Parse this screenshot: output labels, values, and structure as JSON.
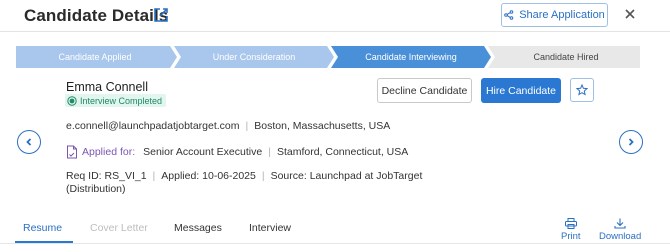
{
  "header": {
    "title": "Candidate Details",
    "share_label": "Share Application",
    "icons": [
      "external-link-icon",
      "share-icon",
      "close-icon"
    ]
  },
  "stepper": {
    "steps": [
      {
        "label": "Candidate Applied",
        "state": "completed"
      },
      {
        "label": "Under Consideration",
        "state": "completed"
      },
      {
        "label": "Candidate Interviewing",
        "state": "current"
      },
      {
        "label": "Candidate Hired",
        "state": "upcoming"
      }
    ],
    "colors": {
      "completed": "#a9c7ec",
      "current": "#4a90d9",
      "upcoming": "#e8e8e8"
    }
  },
  "candidate": {
    "name": "Emma Connell",
    "status": "Interview Completed",
    "email": "e.connell@launchpadatjobtarget.com",
    "location": "Boston, Massachusetts, USA",
    "applied_for_label": "Applied for:",
    "position": "Senior Account Executive",
    "position_location": "Stamford, Connecticut, USA",
    "req_id": "Req ID: RS_VI_1",
    "applied_date": "Applied: 10-06-2025",
    "source": "Source: Launchpad at JobTarget",
    "source_suffix": "(Distribution)"
  },
  "actions": {
    "decline_label": "Decline Candidate",
    "hire_label": "Hire Candidate",
    "star_icon": "star-icon"
  },
  "tabs": [
    {
      "label": "Resume",
      "state": "active"
    },
    {
      "label": "Cover Letter",
      "state": "disabled"
    },
    {
      "label": "Messages",
      "state": "normal"
    },
    {
      "label": "Interview",
      "state": "normal"
    }
  ],
  "tools": {
    "print_label": "Print",
    "download_label": "Download"
  },
  "colors": {
    "accent": "#2b78d3",
    "status_green": "#1f8a66",
    "applied_purple": "#7b55b3"
  }
}
